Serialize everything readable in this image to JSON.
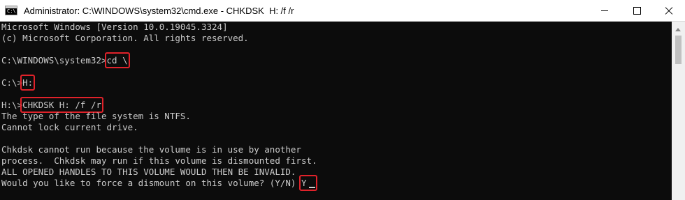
{
  "window": {
    "title": "Administrator: C:\\WINDOWS\\system32\\cmd.exe - CHKDSK  H: /f /r",
    "icon_label": "C:\\"
  },
  "icons": {
    "app": "cmd-console-icon",
    "minimize": "minimize-icon",
    "maximize": "maximize-icon",
    "close": "close-icon",
    "scroll_up": "arrow-up-icon"
  },
  "colors": {
    "background": "#0c0c0c",
    "text": "#cccccc",
    "highlight": "#e0222a"
  },
  "console": {
    "header_line1": "Microsoft Windows [Version 10.0.19045.3324]",
    "header_line2": "(c) Microsoft Corporation. All rights reserved.",
    "prompt1": "C:\\WINDOWS\\system32>",
    "cmd1": "cd \\",
    "prompt2": "C:\\>",
    "cmd2": "H:",
    "prompt3": "H:\\>",
    "cmd3": "CHKDSK H: /f /r",
    "out1": "The type of the file system is NTFS.",
    "out2": "Cannot lock current drive.",
    "out3": "Chkdsk cannot run because the volume is in use by another",
    "out4": "process.  Chkdsk may run if this volume is dismounted first.",
    "out5": "ALL OPENED HANDLES TO THIS VOLUME WOULD THEN BE INVALID.",
    "out6": "Would you like to force a dismount on this volume? (Y/N) ",
    "answer": "Y"
  }
}
